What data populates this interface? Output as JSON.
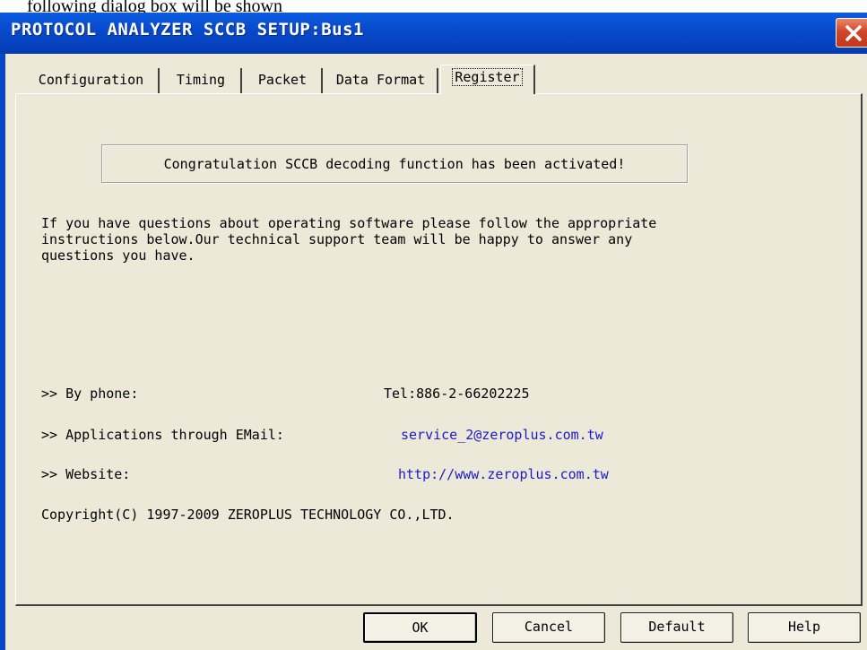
{
  "page_caption": "following dialog box will be shown",
  "window": {
    "title": "PROTOCOL ANALYZER SCCB SETUP:Bus1"
  },
  "tabs": [
    {
      "label": "Configuration"
    },
    {
      "label": "Timing"
    },
    {
      "label": "Packet"
    },
    {
      "label": "Data Format"
    },
    {
      "label": "Register",
      "active": true
    }
  ],
  "notice": "Congratulation SCCB decoding function has been activated!",
  "description": {
    "line1": "If you have questions about operating software please follow the appropriate",
    "line2": "instructions below.Our technical support team will be happy to answer any",
    "line3": "questions you have."
  },
  "contacts": {
    "phone": {
      "label": ">> By phone:",
      "value": "Tel:886-2-66202225"
    },
    "email": {
      "label": ">> Applications through EMail:",
      "value": "service_2@zeroplus.com.tw"
    },
    "website": {
      "label": ">> Website:",
      "value": "http://www.zeroplus.com.tw"
    }
  },
  "copyright": "Copyright(C) 1997-2009 ZEROPLUS TECHNOLOGY CO.,LTD.",
  "buttons": {
    "ok": "OK",
    "cancel": "Cancel",
    "default": "Default",
    "help": "Help"
  },
  "colors": {
    "titlebar": "#0747c7",
    "dialog_bg": "#ece9d8",
    "link": "#1a1acc",
    "close_button": "#d2452b"
  },
  "icons": {
    "close": "close-icon"
  }
}
